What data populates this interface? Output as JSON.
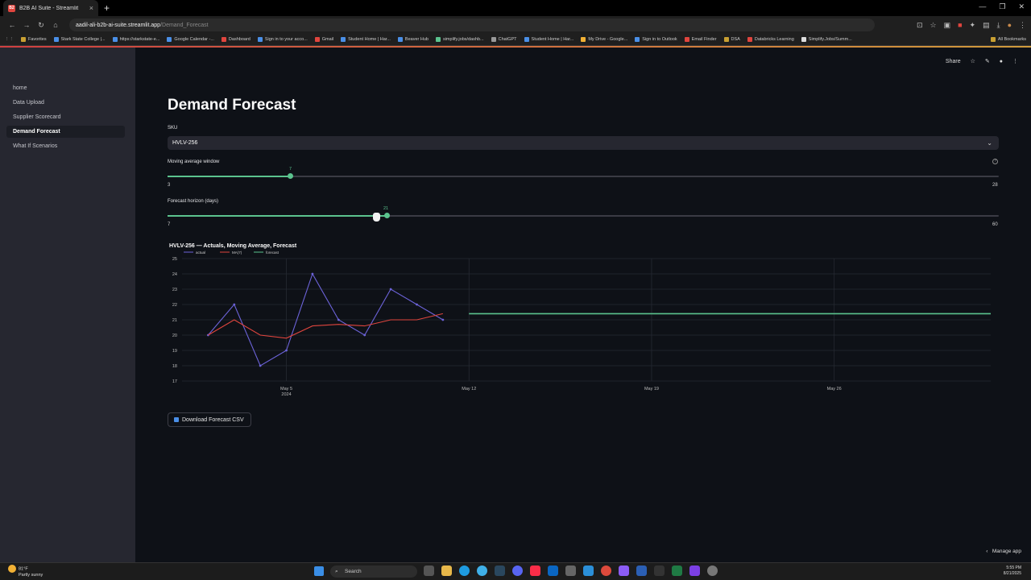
{
  "browser": {
    "tab_title": "B2B AI Suite - Streamlit",
    "url_host": "aadil-ali-b2b-ai-suite.streamlit.app",
    "url_path": "/Demand_Forecast",
    "bookmarks": [
      "Favorites",
      "Stark State College |...",
      "https://starkstate-e...",
      "Google Calendar -...",
      "Dashboard",
      "Sign in to your acco...",
      "Gmail",
      "Student Home | Har...",
      "Beaver Hub",
      "simplify.jobs/dashb...",
      "ChatGPT",
      "Student Home | Har...",
      "My Drive - Google...",
      "Sign in to Outlook",
      "Email Finder",
      "DSA",
      "Databricks Learning",
      "Simplify.Jobs/Summ..."
    ],
    "all_bookmarks": "All Bookmarks"
  },
  "sidebar": {
    "items": [
      {
        "label": "home"
      },
      {
        "label": "Data Upload"
      },
      {
        "label": "Supplier Scorecard"
      },
      {
        "label": "Demand Forecast"
      },
      {
        "label": "What If Scenarios"
      }
    ]
  },
  "header": {
    "share": "Share"
  },
  "main": {
    "title": "Demand Forecast",
    "sku_label": "SKU",
    "sku_value": "HVLV-256",
    "ma_label": "Moving average window",
    "ma_value": "7",
    "ma_min": "3",
    "ma_max": "28",
    "horizon_label": "Forecast horizon (days)",
    "horizon_value": "21",
    "horizon_min": "7",
    "horizon_max": "60",
    "download_label": "Download Forecast CSV",
    "manage_app": "Manage app"
  },
  "chart_data": {
    "type": "line",
    "title": "HVLV-256 — Actuals, Moving Average, Forecast",
    "xlabel": "",
    "ylabel": "",
    "ylim": [
      17,
      25
    ],
    "x_tick_labels": [
      "May 5\n2024",
      "May 12",
      "May 19",
      "May 26"
    ],
    "y_ticks": [
      17,
      18,
      19,
      20,
      21,
      22,
      23,
      24,
      25
    ],
    "legend_position": "top-left",
    "series": [
      {
        "name": "actual",
        "color": "#6c63d9",
        "x": [
          "2024-05-02",
          "2024-05-03",
          "2024-05-04",
          "2024-05-05",
          "2024-05-06",
          "2024-05-07",
          "2024-05-08",
          "2024-05-09",
          "2024-05-10",
          "2024-05-11"
        ],
        "values": [
          20,
          22,
          18,
          19,
          24,
          21,
          20,
          23,
          22,
          21
        ]
      },
      {
        "name": "MA(7)",
        "color": "#e0453e",
        "x": [
          "2024-05-02",
          "2024-05-03",
          "2024-05-04",
          "2024-05-05",
          "2024-05-06",
          "2024-05-07",
          "2024-05-08",
          "2024-05-09",
          "2024-05-10",
          "2024-05-11"
        ],
        "values": [
          20,
          21,
          20,
          19.8,
          20.6,
          20.7,
          20.6,
          21,
          21,
          21.4
        ]
      },
      {
        "name": "forecast",
        "color": "#5bc38e",
        "x": [
          "2024-05-12",
          "2024-06-01"
        ],
        "values": [
          21.4,
          21.4
        ]
      }
    ]
  },
  "taskbar": {
    "weather_temp": "81°F",
    "weather_desc": "Partly sunny",
    "search": "Search",
    "time": "5:55 PM",
    "date": "8/21/2025"
  }
}
